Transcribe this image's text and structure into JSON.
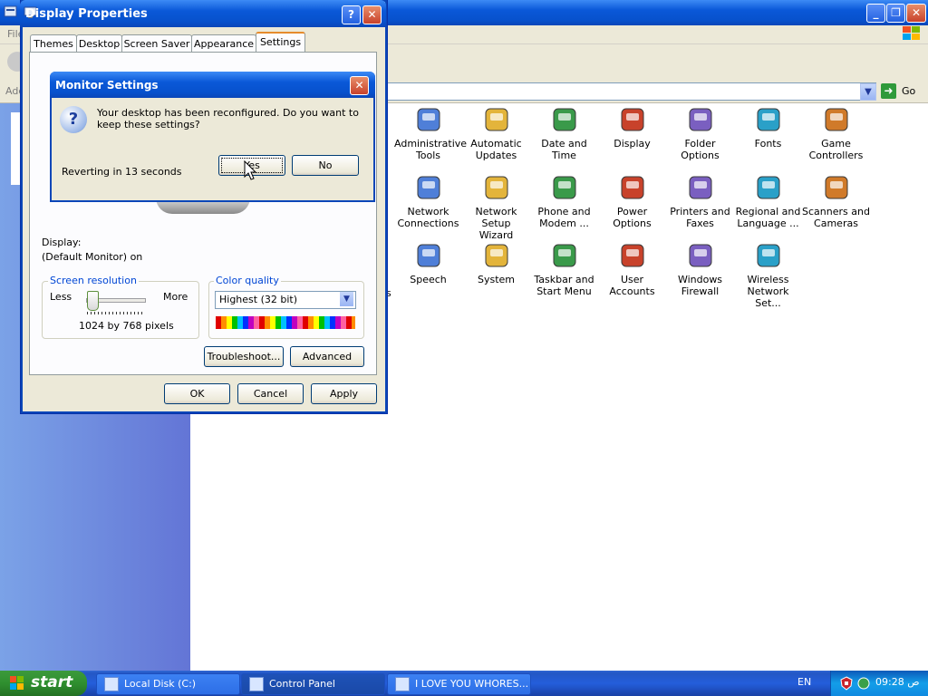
{
  "control_panel": {
    "menu_file": "File",
    "address_label": "Address",
    "go_label": "Go",
    "items": [
      {
        "label1": "Administrative",
        "label2": "Tools",
        "icon": "administrative-tools-icon"
      },
      {
        "label1": "Automatic",
        "label2": "Updates",
        "icon": "automatic-updates-icon"
      },
      {
        "label1": "Date and Time",
        "label2": "",
        "icon": "date-time-icon"
      },
      {
        "label1": "Display",
        "label2": "",
        "icon": "display-icon"
      },
      {
        "label1": "Folder Options",
        "label2": "",
        "icon": "folder-options-icon"
      },
      {
        "label1": "Fonts",
        "label2": "",
        "icon": "fonts-icon"
      },
      {
        "label1": "Game",
        "label2": "Controllers",
        "icon": "game-controllers-icon"
      },
      {
        "label1": "Network",
        "label2": "Connections",
        "icon": "network-connections-icon"
      },
      {
        "label1": "Network Setup",
        "label2": "Wizard",
        "icon": "network-setup-wizard-icon"
      },
      {
        "label1": "Phone and",
        "label2": "Modem ...",
        "icon": "phone-modem-icon"
      },
      {
        "label1": "Power Options",
        "label2": "",
        "icon": "power-options-icon"
      },
      {
        "label1": "Printers and",
        "label2": "Faxes",
        "icon": "printers-faxes-icon"
      },
      {
        "label1": "Regional and",
        "label2": "Language ...",
        "icon": "regional-language-icon"
      },
      {
        "label1": "Scanners and",
        "label2": "Cameras",
        "icon": "scanners-cameras-icon"
      },
      {
        "label1": "Speech",
        "label2": "",
        "icon": "speech-icon"
      },
      {
        "label1": "System",
        "label2": "",
        "icon": "system-icon"
      },
      {
        "label1": "Taskbar and",
        "label2": "Start Menu",
        "icon": "taskbar-start-menu-icon"
      },
      {
        "label1": "User Accounts",
        "label2": "",
        "icon": "user-accounts-icon"
      },
      {
        "label1": "Windows",
        "label2": "Firewall",
        "icon": "windows-firewall-icon"
      },
      {
        "label1": "Wireless",
        "label2": "Network Set...",
        "icon": "wireless-network-icon"
      }
    ],
    "clipped_label": "s"
  },
  "display_properties": {
    "title": "Display Properties",
    "tabs": [
      "Themes",
      "Desktop",
      "Screen Saver",
      "Appearance",
      "Settings"
    ],
    "active_tab": "Settings",
    "display_label": "Display:",
    "display_value": "(Default Monitor) on",
    "resolution_legend": "Screen resolution",
    "less_label": "Less",
    "more_label": "More",
    "resolution_value": "1024 by 768 pixels",
    "color_legend": "Color quality",
    "color_value": "Highest (32 bit)",
    "troubleshoot_label": "Troubleshoot...",
    "advanced_label": "Advanced",
    "ok_label": "OK",
    "cancel_label": "Cancel",
    "apply_label": "Apply"
  },
  "monitor_settings": {
    "title": "Monitor Settings",
    "message": "Your desktop has been reconfigured.  Do you want to keep these settings?",
    "countdown": "Reverting in 13 seconds",
    "yes_label": "Yes",
    "no_label": "No"
  },
  "taskbar": {
    "start_label": "start",
    "tasks": [
      "Local Disk (C:)",
      "Control Panel",
      "I LOVE YOU WHORES..."
    ],
    "language": "EN",
    "clock": "09:28 ص"
  },
  "colors": {
    "xp_blue": "#0a58d8",
    "start_green": "#2f8f2f",
    "sidebar_blue": "#6f8fdf"
  }
}
